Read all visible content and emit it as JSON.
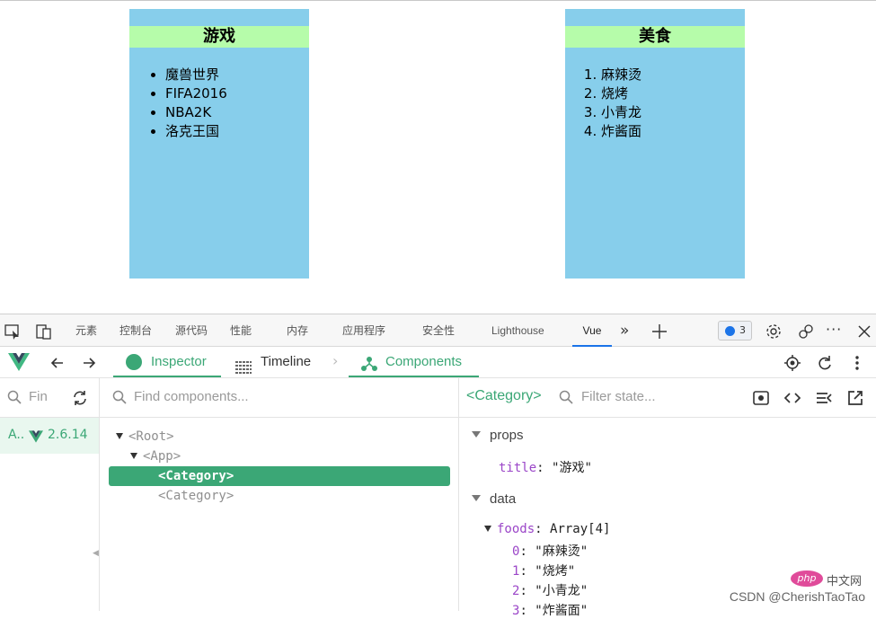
{
  "cards": [
    {
      "title": "游戏",
      "items": [
        "魔兽世界",
        "FIFA2016",
        "NBA2K",
        "洛克王国"
      ]
    },
    {
      "title": "美食",
      "items": [
        "麻辣烫",
        "烧烤",
        "小青龙",
        "炸酱面"
      ]
    }
  ],
  "devtools_tabs": [
    "元素",
    "控制台",
    "源代码",
    "性能",
    "内存",
    "应用程序",
    "安全性",
    "Lighthouse",
    "Vue"
  ],
  "issues_count": "3",
  "vue_tabs": {
    "inspector": "Inspector",
    "timeline": "Timeline",
    "components": "Components"
  },
  "apps_search_placeholder": "Fin",
  "app_item": {
    "name": "A..",
    "version": "2.6.14"
  },
  "find_components_placeholder": "Find components...",
  "tree": {
    "root": "<Root>",
    "app": "<App>",
    "selected": "<Category>",
    "other": "<Category>"
  },
  "state": {
    "component": "<Category>",
    "filter_placeholder": "Filter state...",
    "props_label": "props",
    "prop_key": "title",
    "prop_value": "\"游戏\"",
    "data_label": "data",
    "foods_key": "foods",
    "foods_type": "Array[4]",
    "foods": [
      {
        "index": "0",
        "value": "\"麻辣烫\""
      },
      {
        "index": "1",
        "value": "\"烧烤\""
      },
      {
        "index": "2",
        "value": "\"小青龙\""
      },
      {
        "index": "3",
        "value": "\"炸酱面\""
      }
    ]
  },
  "watermark": {
    "logo": "php",
    "site": "中文网",
    "text": "CSDN @CherishTaoTao"
  },
  "colors": {
    "card_bg": "#87ceeb",
    "card_title_bg": "#b6fcaa",
    "vue_green": "#3ba776",
    "key_purple": "#9b46c8"
  }
}
